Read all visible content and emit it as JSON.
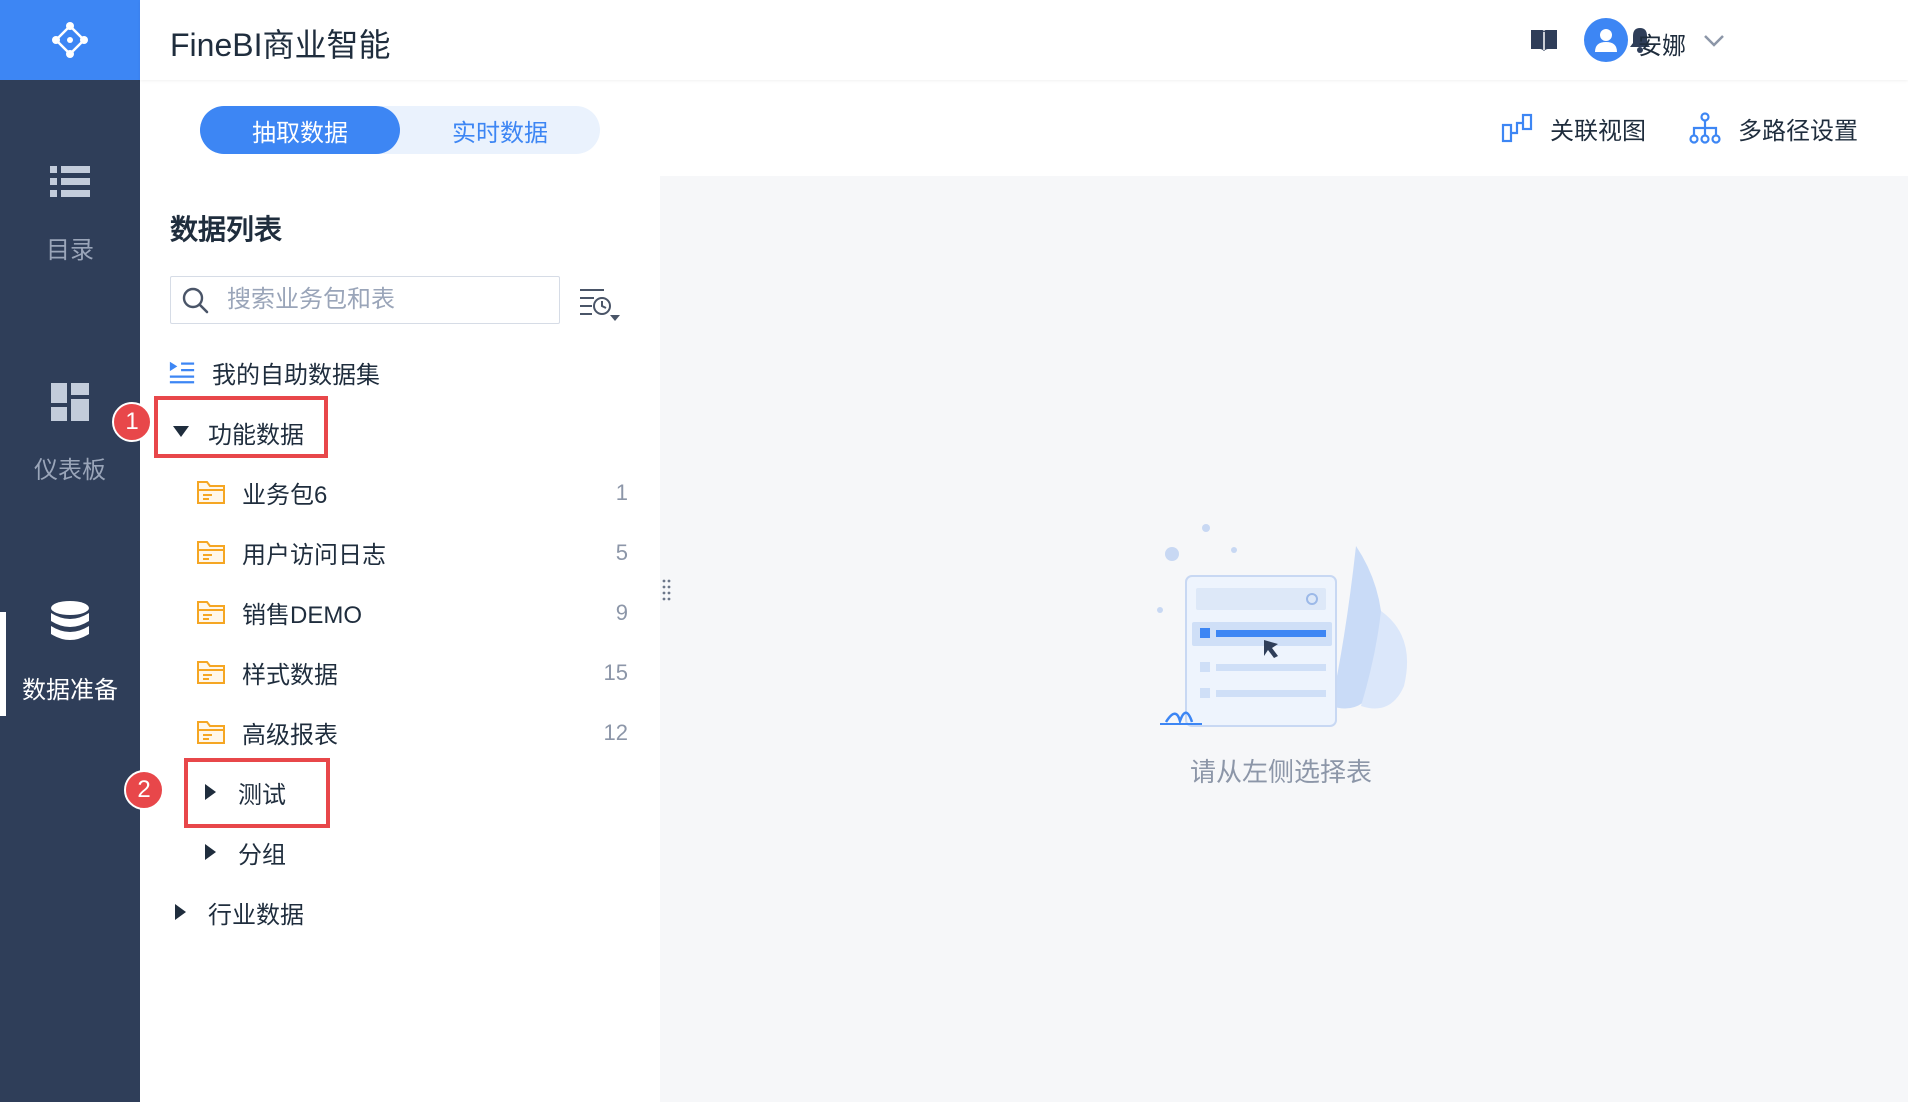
{
  "app": {
    "title": "FineBI商业智能"
  },
  "user": {
    "name": "安娜"
  },
  "nav": {
    "items": [
      {
        "label": "目录",
        "icon": "list-icon"
      },
      {
        "label": "仪表板",
        "icon": "dashboard-icon"
      },
      {
        "label": "数据准备",
        "icon": "database-icon",
        "active": true
      }
    ]
  },
  "tabs": {
    "extract": "抽取数据",
    "realtime": "实时数据"
  },
  "toolbar": {
    "relation_view": "关联视图",
    "multipath": "多路径设置"
  },
  "panel": {
    "title": "数据列表",
    "search_placeholder": "搜索业务包和表",
    "my_dataset": "我的自助数据集",
    "group_func": "功能数据",
    "packages": [
      {
        "name": "业务包6",
        "count": "1"
      },
      {
        "name": "用户访问日志",
        "count": "5"
      },
      {
        "name": "销售DEMO",
        "count": "9"
      },
      {
        "name": "样式数据",
        "count": "15"
      },
      {
        "name": "高级报表",
        "count": "12"
      }
    ],
    "sub_test": "测试",
    "sub_group": "分组",
    "group_industry": "行业数据"
  },
  "annotations": {
    "one": "1",
    "two": "2"
  },
  "empty": {
    "text": "请从左侧选择表"
  },
  "colors": {
    "accent": "#3d86f4",
    "nav_bg": "#2f3e59",
    "annotation": "#e8474a",
    "folder": "#f5a623"
  }
}
